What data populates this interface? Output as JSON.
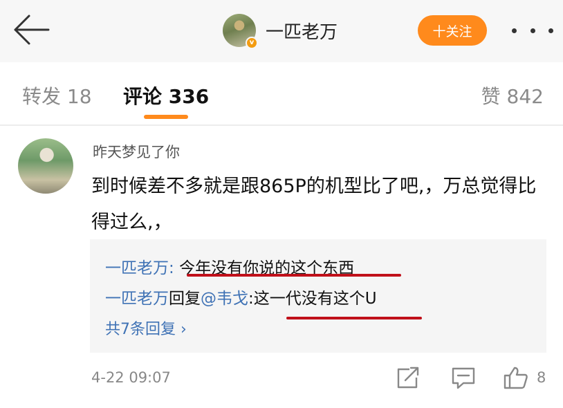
{
  "header": {
    "user_name": "一匹老万",
    "follow_label": "十关注",
    "verified_mark": "v"
  },
  "tabs": {
    "repost": "转发 18",
    "comments": "评论 336",
    "likes": "赞 842"
  },
  "comment": {
    "author": "昨天梦见了你",
    "text": "到时候差不多就是跟865P的机型比了吧,，万总觉得比得过么,，",
    "replies": [
      {
        "name": "一匹老万",
        "separator": ": ",
        "text": "今年没有你说的这个东西"
      },
      {
        "name": "一匹老万",
        "middle": "回复",
        "mention": "@韦戈",
        "separator": ":",
        "text": "这一代没有这个U"
      }
    ],
    "more_replies": "共7条回复 ›",
    "timestamp": "4-22 09:07",
    "like_count": "8"
  },
  "colors": {
    "accent": "#ff8a1c",
    "link": "#3f72b5",
    "annotation": "#c0101a"
  },
  "icons": [
    "back-arrow-icon",
    "verified-badge-icon",
    "more-dots-icon",
    "share-icon",
    "comment-icon",
    "like-icon"
  ]
}
